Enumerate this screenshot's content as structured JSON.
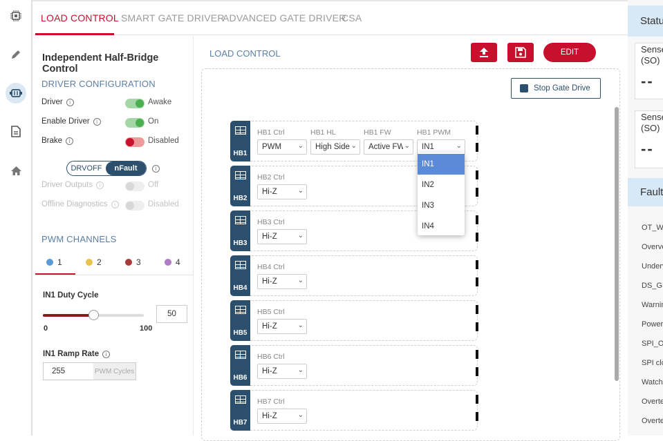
{
  "tabs": [
    {
      "label": "LOAD CONTROL",
      "active": true
    },
    {
      "label": "SMART GATE DRIVER",
      "active": false
    },
    {
      "label": "ADVANCED GATE DRIVER",
      "active": false
    },
    {
      "label": "CSA",
      "active": false
    }
  ],
  "left_panel": {
    "title": "Independent Half-Bridge Control",
    "driver_config": {
      "heading": "DRIVER CONFIGURATION",
      "rows": [
        {
          "label": "Driver",
          "state": "Awake",
          "color": "#4caf50"
        },
        {
          "label": "Enable Driver",
          "state": "On",
          "color": "#4caf50"
        },
        {
          "label": "Brake",
          "state": "Disabled",
          "color": "#c8102e"
        }
      ],
      "segmented": {
        "option1": "DRVOFF",
        "option2": "nFault",
        "selected": "nFault"
      },
      "disabled_rows": [
        {
          "label": "Driver Outputs",
          "state": "Off"
        },
        {
          "label": "Offline Diagnostics",
          "state": "Disabled"
        }
      ]
    },
    "pwm": {
      "heading": "PWM CHANNELS",
      "channels": [
        {
          "label": "1",
          "color": "#5a9bd4"
        },
        {
          "label": "2",
          "color": "#e8c24a"
        },
        {
          "label": "3",
          "color": "#a93a3a"
        },
        {
          "label": "4",
          "color": "#b07cc6"
        }
      ],
      "selected_channel": "1",
      "duty_label": "IN1 Duty Cycle",
      "duty_value": "50",
      "duty_min": "0",
      "duty_max": "100",
      "ramp_label": "IN1 Ramp Rate",
      "ramp_value": "255",
      "ramp_unit": "PWM Cycles"
    }
  },
  "main": {
    "title": "LOAD CONTROL",
    "buttons": {
      "upload": "upload-icon",
      "save": "save-icon",
      "edit_label": "EDIT"
    },
    "stop_label": "Stop Gate Drive",
    "hb_rows": [
      {
        "badge": "HB1",
        "ctrl_label": "HB1 Ctrl",
        "ctrl_value": "PWM",
        "hl_label": "HB1 HL",
        "hl_value": "High Side",
        "fw_label": "HB1 FW",
        "fw_value": "Active FW",
        "pwm_label": "HB1 PWM",
        "pwm_value": "IN1"
      },
      {
        "badge": "HB2",
        "ctrl_label": "HB2 Ctrl",
        "ctrl_value": "Hi-Z"
      },
      {
        "badge": "HB3",
        "ctrl_label": "HB3 Ctrl",
        "ctrl_value": "Hi-Z"
      },
      {
        "badge": "HB4",
        "ctrl_label": "HB4 Ctrl",
        "ctrl_value": "Hi-Z"
      },
      {
        "badge": "HB5",
        "ctrl_label": "HB5 Ctrl",
        "ctrl_value": "Hi-Z"
      },
      {
        "badge": "HB6",
        "ctrl_label": "HB6 Ctrl",
        "ctrl_value": "Hi-Z"
      },
      {
        "badge": "HB7",
        "ctrl_label": "HB7 Ctrl",
        "ctrl_value": "Hi-Z"
      }
    ],
    "pwm_dropdown": {
      "options": [
        "IN1",
        "IN2",
        "IN3",
        "IN4"
      ],
      "selected": "IN1"
    }
  },
  "status_panel": {
    "heading": "Status",
    "cards": [
      {
        "title": "Sense",
        "subtitle": "(SO)",
        "value": "--"
      },
      {
        "title": "Sense",
        "subtitle": "(SO)",
        "value": "--"
      }
    ],
    "fault_heading": "Fault/",
    "fault_items": [
      "OT_WI",
      "Overvo",
      "Underv",
      "DS_GS",
      "Warnin",
      "Power",
      "SPI_OI",
      "SPI clo",
      "Watch",
      "Overte",
      "Overte"
    ]
  }
}
